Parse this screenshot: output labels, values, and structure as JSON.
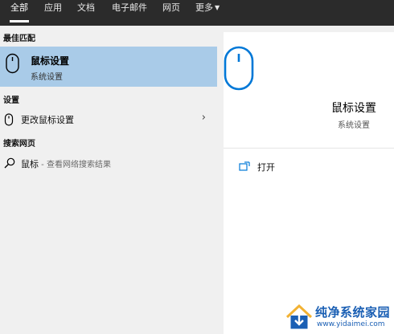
{
  "tabs": [
    {
      "label": "全部",
      "active": true
    },
    {
      "label": "应用"
    },
    {
      "label": "文档"
    },
    {
      "label": "电子邮件"
    },
    {
      "label": "网页"
    },
    {
      "label": "更多"
    }
  ],
  "left": {
    "best_match_heading": "最佳匹配",
    "best_match": {
      "title": "鼠标设置",
      "subtitle": "系统设置",
      "icon": "mouse-icon"
    },
    "settings_heading": "设置",
    "settings_item": {
      "label": "更改鼠标设置",
      "icon": "mouse-icon"
    },
    "web_heading": "搜索网页",
    "web_item": {
      "term": "鼠标",
      "hint": " - 查看网络搜索结果",
      "icon": "search-icon"
    }
  },
  "preview": {
    "title": "鼠标设置",
    "subtitle": "系统设置",
    "action_label": "打开",
    "icon": "mouse-icon"
  },
  "watermark": {
    "title": "纯净系统家园",
    "url": "www.yidaimei.com"
  },
  "colors": {
    "selected": "#a9cbe8",
    "accent": "#0078d7",
    "topbar": "#2b2b2b"
  }
}
